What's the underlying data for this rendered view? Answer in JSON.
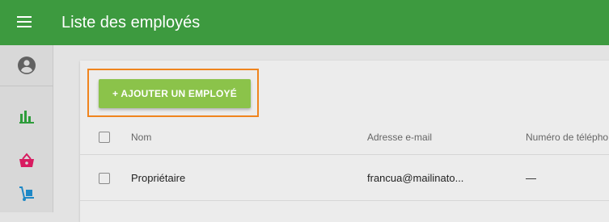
{
  "app": {
    "title": "Liste des employés",
    "menu_icon": "hamburger-menu-icon",
    "colors": {
      "appbar": "#3d9a3f",
      "accent_button": "#8bc34a",
      "highlight": "#f0841e"
    }
  },
  "sidebar": {
    "items": [
      {
        "icon": "account-circle-icon",
        "color": "#616161"
      },
      {
        "icon": "bar-chart-icon",
        "color": "#2e9c3b"
      },
      {
        "icon": "shopping-basket-icon",
        "color": "#d81b60"
      },
      {
        "icon": "hand-truck-icon",
        "color": "#1e88c6"
      }
    ]
  },
  "main": {
    "add_button_label": "+ AJOUTER UN EMPLOYÉ",
    "table": {
      "columns": [
        "Nom",
        "Adresse e-mail",
        "Numéro de télépho"
      ],
      "rows": [
        {
          "name": "Propriétaire",
          "email": "francua@mailinato...",
          "phone": "—"
        }
      ]
    }
  }
}
